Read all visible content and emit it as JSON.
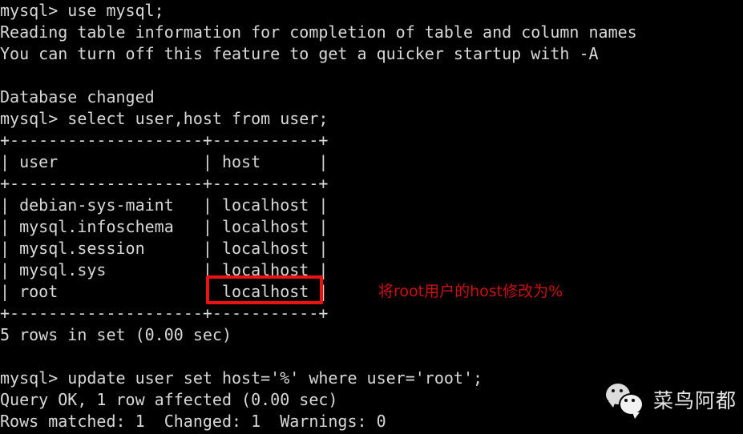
{
  "terminal": {
    "background_color": "#000000",
    "text_color": "#d8d8d8",
    "lines": [
      "mysql> use mysql;",
      "Reading table information for completion of table and column names",
      "You can turn off this feature to get a quicker startup with -A",
      "",
      "Database changed",
      "mysql> select user,host from user;",
      "+--------------------+-----------+",
      "| user               | host      |",
      "+--------------------+-----------+",
      "| debian-sys-maint   | localhost |",
      "| mysql.infoschema   | localhost |",
      "| mysql.session      | localhost |",
      "| mysql.sys          | localhost |",
      "| root               | localhost |",
      "+--------------------+-----------+",
      "5 rows in set (0.00 sec)",
      "",
      "mysql> update user set host='%' where user='root';",
      "Query OK, 1 row affected (0.00 sec)",
      "Rows matched: 1  Changed: 1  Warnings: 0"
    ]
  },
  "query_result": {
    "type": "table",
    "columns": [
      "user",
      "host"
    ],
    "rows": [
      [
        "debian-sys-maint",
        "localhost"
      ],
      [
        "mysql.infoschema",
        "localhost"
      ],
      [
        "mysql.session",
        "localhost"
      ],
      [
        "mysql.sys",
        "localhost"
      ],
      [
        "root",
        "localhost"
      ]
    ],
    "footer": "5 rows in set (0.00 sec)",
    "row_count": 5
  },
  "annotation": {
    "text": "将root用户的host修改为%",
    "color": "#cc1111",
    "highlight_color": "#ee1111",
    "highlighted_value": "localhost"
  },
  "watermark": {
    "icon": "wechat-icon",
    "label": "菜鸟阿都",
    "color": "#e6e6e6"
  }
}
